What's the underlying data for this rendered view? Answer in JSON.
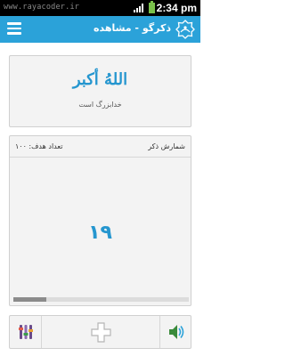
{
  "status_bar": {
    "watermark": "www.rayacoder.ir",
    "time": "2:34 pm",
    "battery_color": "#7ac14b"
  },
  "app_bar": {
    "title": "ذکرگو - مشاهده",
    "background": "#2ba2d9",
    "menu_icon": "hamburger-icon",
    "logo_icon": "app-logo-icon"
  },
  "zikr": {
    "arabic": "اللهُ أكبر",
    "translation": "خدابزرگ است"
  },
  "counter": {
    "label": "شمارش ذکر",
    "target": "تعداد هدف: ۱۰۰",
    "count": "۱۹",
    "progress_fraction": 0.19
  },
  "bottom_bar": {
    "left_icon": "equalizer-settings-icon",
    "middle_icon": "plus-icon",
    "right_icon": "speaker-sound-icon"
  },
  "accent": "#2596cf"
}
